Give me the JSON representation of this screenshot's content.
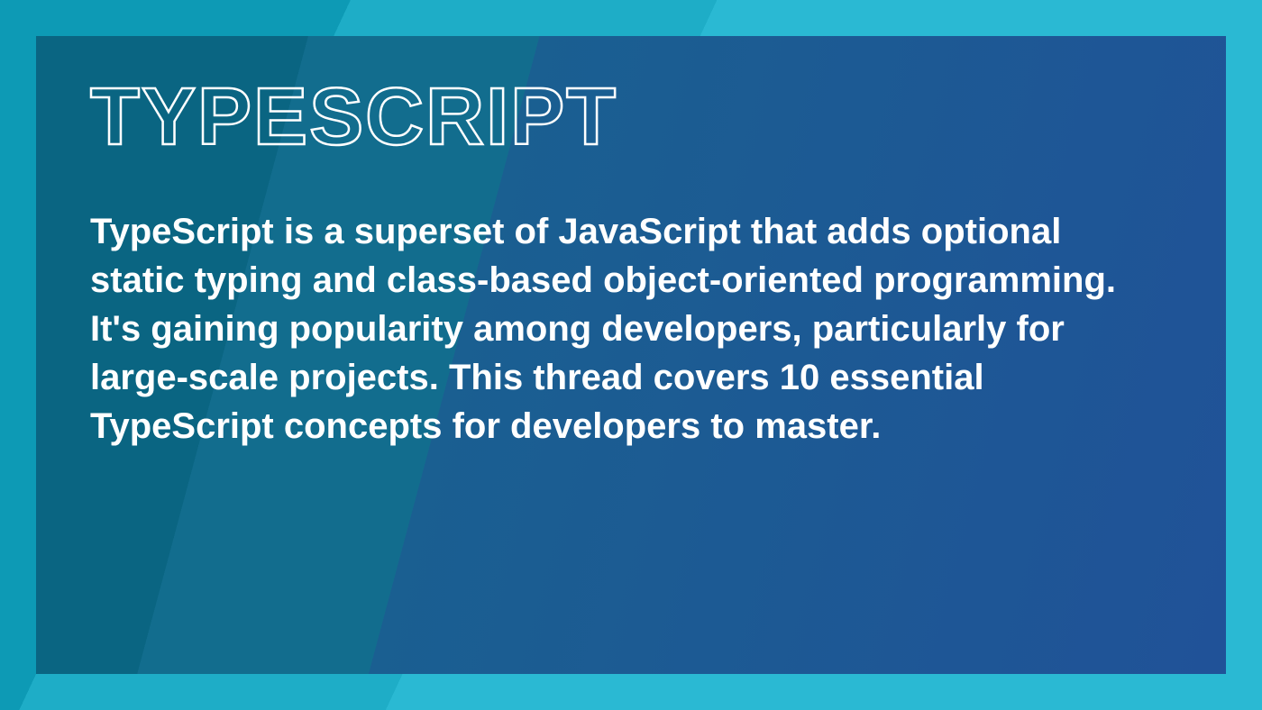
{
  "slide": {
    "title": "TYPESCRIPT",
    "body": "TypeScript is a superset of JavaScript that adds optional static typing and class-based object-oriented programming. It's gaining popularity among developers, particularly for large-scale projects. This thread covers 10 essential TypeScript concepts for developers to master."
  },
  "colors": {
    "outer_frame": "#0d9ab5",
    "inner_panel_start": "#0a6582",
    "inner_panel_end": "#1b5f8f",
    "text": "#ffffff"
  }
}
